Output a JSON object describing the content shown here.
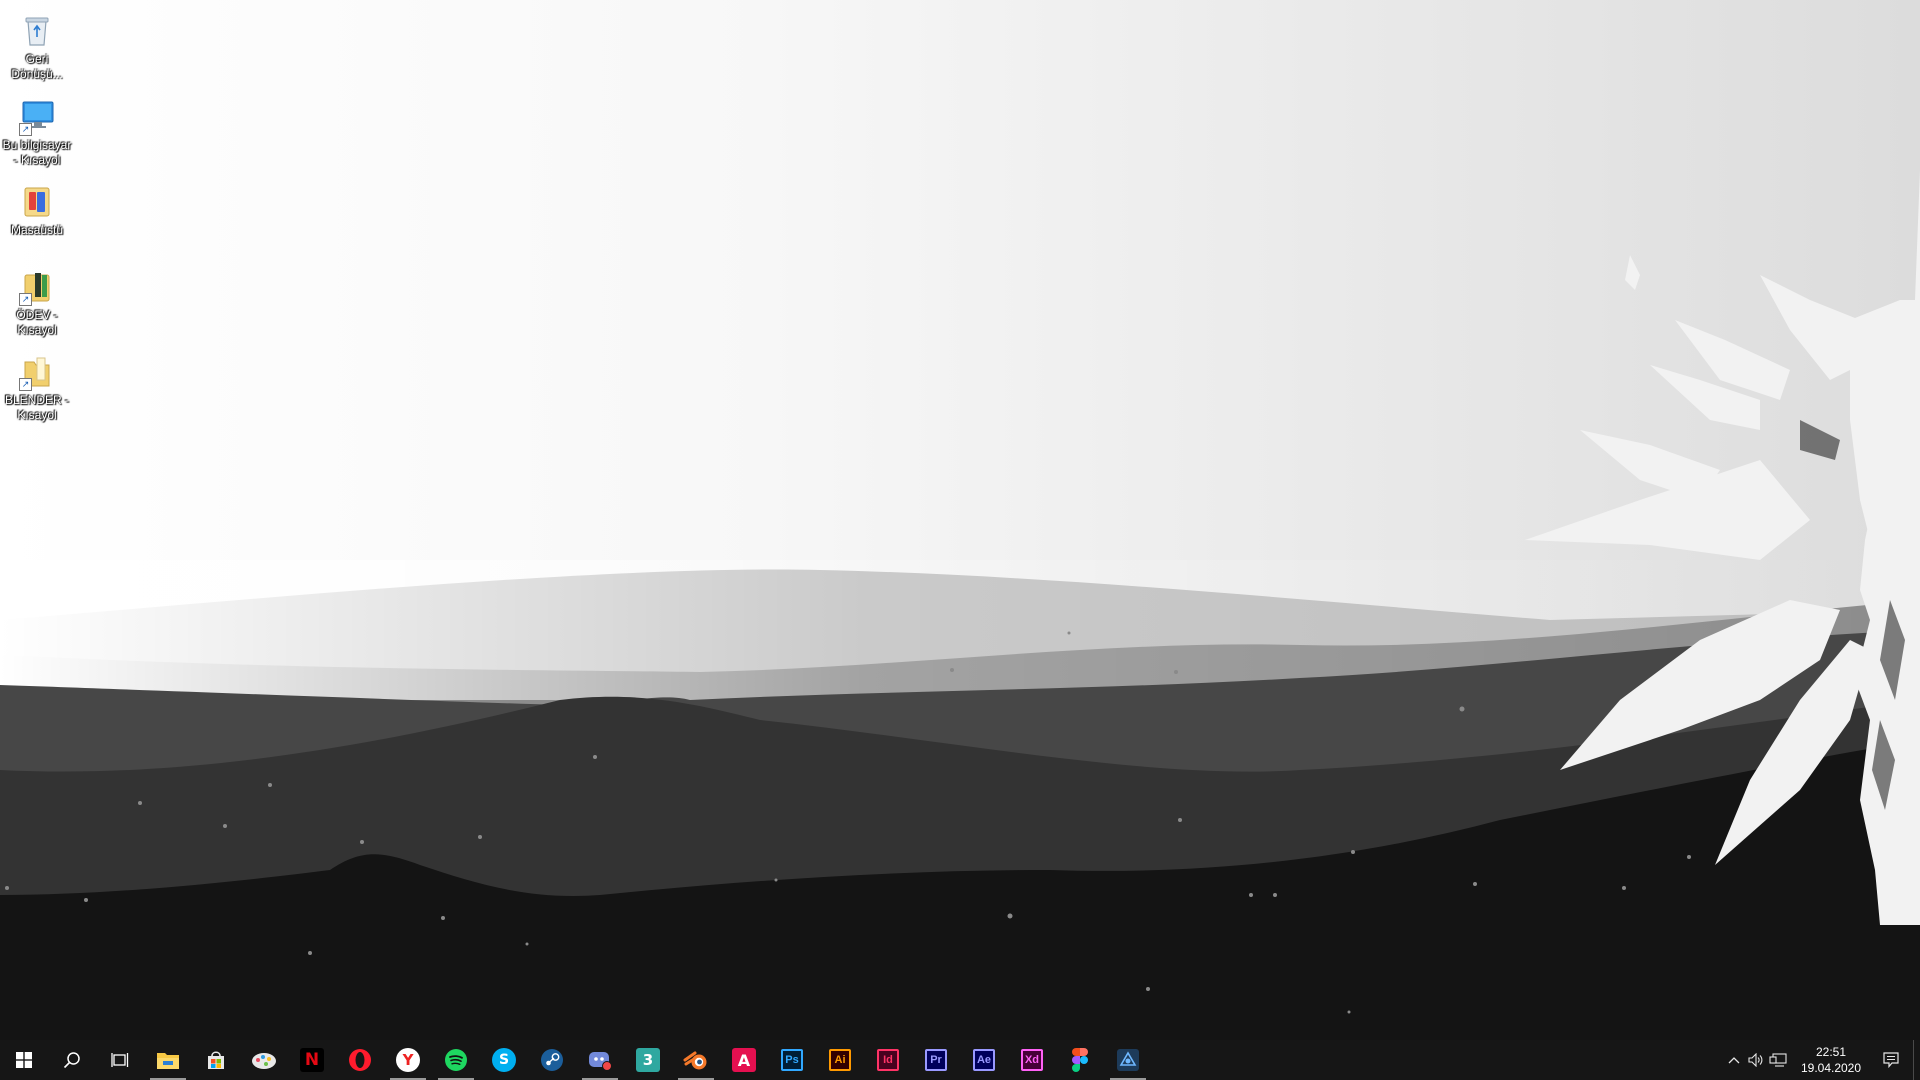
{
  "desktop": {
    "icons": [
      {
        "label": "Geri Dönüşü...",
        "icon": "recycle-bin-icon"
      },
      {
        "label": "Bu bilgisayar - Kısayol",
        "icon": "this-pc-icon"
      },
      {
        "label": "Masaüstü",
        "icon": "desktop-folder-icon"
      },
      {
        "label": "ÖDEV - Kısayol",
        "icon": "folder-shortcut-icon"
      },
      {
        "label": "BLENDER - Kısayol",
        "icon": "folder-shortcut-icon"
      }
    ]
  },
  "taskbar": {
    "start": "windows-start-icon",
    "search": "search-icon",
    "task_view": "task-view-icon",
    "apps": [
      {
        "name": "file-explorer-icon",
        "running": true
      },
      {
        "name": "microsoft-store-icon",
        "running": false
      },
      {
        "name": "paint-3d-icon",
        "running": false
      },
      {
        "name": "netflix-icon",
        "running": false,
        "text": "N"
      },
      {
        "name": "opera-icon",
        "running": false
      },
      {
        "name": "yandex-browser-icon",
        "running": true,
        "text": "Y"
      },
      {
        "name": "spotify-icon",
        "running": true
      },
      {
        "name": "skype-icon",
        "running": false,
        "text": "S"
      },
      {
        "name": "steam-icon",
        "running": false
      },
      {
        "name": "discord-icon",
        "running": true
      },
      {
        "name": "3d-builder-icon",
        "running": false,
        "text": "3"
      },
      {
        "name": "blender-icon",
        "running": true
      },
      {
        "name": "autocad-icon",
        "running": false,
        "text": "A"
      },
      {
        "name": "photoshop-icon",
        "running": false,
        "text": "Ps",
        "color": "#31a8ff"
      },
      {
        "name": "illustrator-icon",
        "running": false,
        "text": "Ai",
        "color": "#ff9a00"
      },
      {
        "name": "indesign-icon",
        "running": false,
        "text": "Id",
        "color": "#ff3366"
      },
      {
        "name": "premiere-pro-icon",
        "running": false,
        "text": "Pr",
        "color": "#9999ff"
      },
      {
        "name": "after-effects-icon",
        "running": false,
        "text": "Ae",
        "color": "#9999ff"
      },
      {
        "name": "adobe-xd-icon",
        "running": false,
        "text": "Xd",
        "color": "#ff61f6"
      },
      {
        "name": "figma-icon",
        "running": false
      },
      {
        "name": "vpn-app-icon",
        "running": true
      }
    ],
    "tray": {
      "chevron": "^",
      "time": "22:51",
      "date": "19.04.2020"
    }
  }
}
